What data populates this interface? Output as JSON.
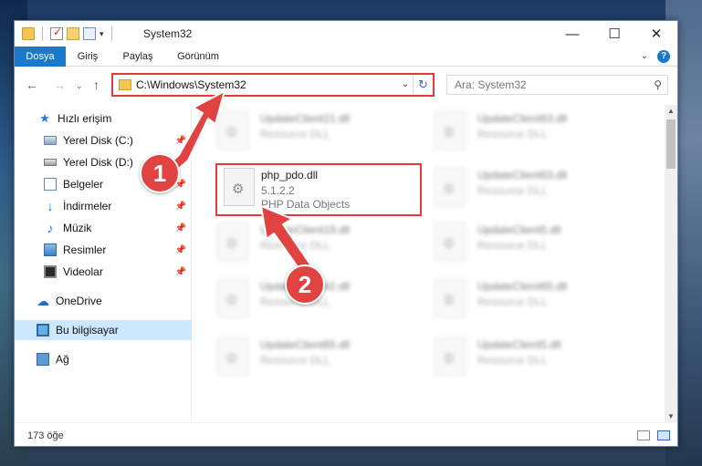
{
  "window": {
    "title": "System32",
    "minimize": "—",
    "maximize": "☐",
    "close": "✕"
  },
  "ribbon": {
    "tabs": [
      "Dosya",
      "Giriş",
      "Paylaş",
      "Görünüm"
    ],
    "help": "?"
  },
  "navigation": {
    "address": "C:\\Windows\\System32",
    "search_placeholder": "Ara: System32"
  },
  "sidebar": {
    "items": [
      {
        "label": "Hızlı erişim",
        "icon": "star-icon"
      },
      {
        "label": "Yerel Disk (C:)",
        "icon": "disk-icon",
        "pinned": true
      },
      {
        "label": "Yerel Disk (D:)",
        "icon": "disk-icon",
        "pinned": true
      },
      {
        "label": "Belgeler",
        "icon": "document-icon",
        "pinned": true
      },
      {
        "label": "İndirmeler",
        "icon": "download-icon",
        "pinned": true
      },
      {
        "label": "Müzik",
        "icon": "music-icon",
        "pinned": true
      },
      {
        "label": "Resimler",
        "icon": "picture-icon",
        "pinned": true
      },
      {
        "label": "Videolar",
        "icon": "video-icon",
        "pinned": true
      },
      {
        "label": "OneDrive",
        "icon": "cloud-icon"
      },
      {
        "label": "Bu bilgisayar",
        "icon": "computer-icon",
        "selected": true
      },
      {
        "label": "Ağ",
        "icon": "network-icon"
      }
    ]
  },
  "files": {
    "highlighted": {
      "name": "php_pdo.dll",
      "version": "5.1.2.2",
      "description": "PHP Data Objects"
    },
    "blurred": [
      {
        "name": "UpdateClient21.dll",
        "description": "Resource DLL"
      },
      {
        "name": "UpdateClient63.dll",
        "description": "Resource DLL"
      },
      {
        "name": "UpdateClient63.dll",
        "description": "Resource DLL"
      },
      {
        "name": "UpdateClient19.dll",
        "description": "Resource DLL"
      },
      {
        "name": "UpdateClient5.dll",
        "description": "Resource DLL"
      },
      {
        "name": "UpdateClient42.dll",
        "description": "Resource DLL"
      },
      {
        "name": "UpdateClient65.dll",
        "description": "Resource DLL"
      },
      {
        "name": "UpdateClient65.dll",
        "description": "Resource DLL"
      },
      {
        "name": "UpdateClient5.dll",
        "description": "Resource DLL"
      }
    ]
  },
  "status": {
    "item_count": "173 öğe"
  },
  "callouts": {
    "step1": "1",
    "step2": "2",
    "color": "#e14242"
  }
}
